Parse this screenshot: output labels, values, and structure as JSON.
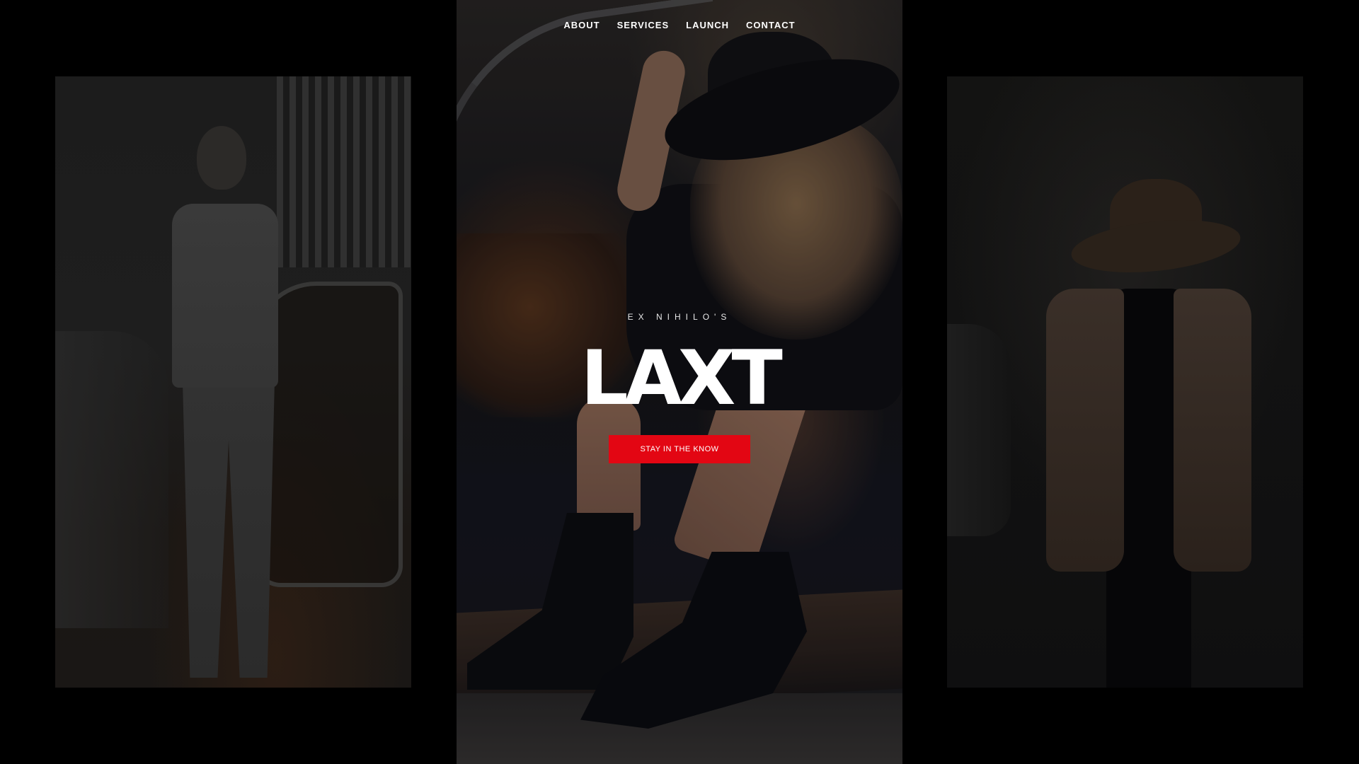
{
  "nav": {
    "items": [
      {
        "label": "ABOUT"
      },
      {
        "label": "SERVICES"
      },
      {
        "label": "LAUNCH"
      },
      {
        "label": "CONTACT"
      }
    ]
  },
  "hero": {
    "eyebrow": "EX NIHILO'S",
    "title": "LAXT",
    "cta_label": "STAY IN THE KNOW"
  },
  "colors": {
    "background": "#000000",
    "accent": "#e30613",
    "text": "#ffffff"
  }
}
